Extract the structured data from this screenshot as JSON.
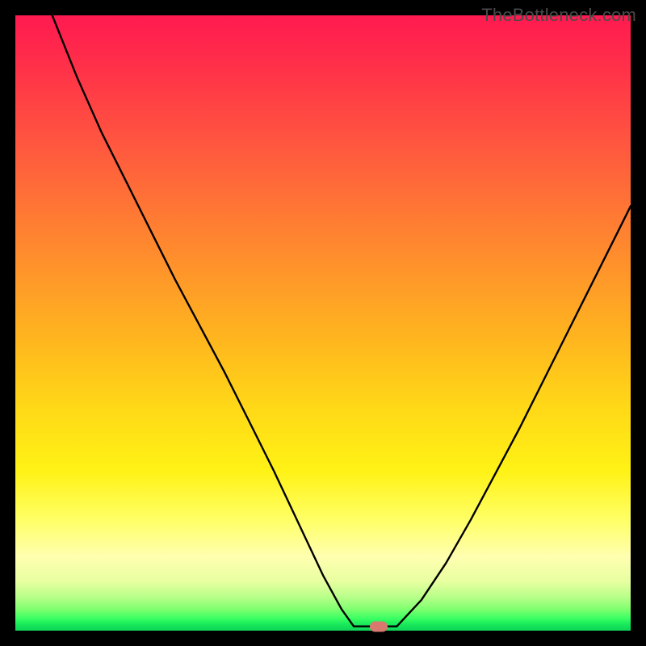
{
  "watermark": "TheBottleneck.com",
  "colors": {
    "frame": "#000000",
    "curve": "#000000",
    "marker": "#d9786f",
    "gradient_top": "#ff1a50",
    "gradient_mid": "#ffd917",
    "gradient_bottom": "#0fd458"
  },
  "chart_data": {
    "type": "line",
    "title": "",
    "xlabel": "",
    "ylabel": "",
    "xlim": [
      0,
      100
    ],
    "ylim": [
      0,
      100
    ],
    "annotations": [
      {
        "type": "marker",
        "x": 59,
        "y": 0.7,
        "fill": "#d9786f"
      }
    ],
    "series": [
      {
        "name": "bottleneck-curve",
        "stroke": "#000000",
        "segments": [
          {
            "x": [
              6,
              10,
              14,
              18,
              22,
              26,
              30,
              34,
              38,
              42,
              46,
              50,
              53,
              55
            ],
            "y": [
              100,
              90,
              81,
              73,
              65,
              57,
              49.5,
              42,
              34,
              26,
              17.5,
              9,
              3.5,
              0.7
            ]
          },
          {
            "x": [
              55,
              62
            ],
            "y": [
              0.7,
              0.7
            ]
          },
          {
            "x": [
              62,
              66,
              70,
              74,
              78,
              82,
              86,
              90,
              94,
              98,
              100
            ],
            "y": [
              0.7,
              5,
              11,
              18,
              25.5,
              33,
              41,
              49,
              57,
              65,
              69
            ]
          }
        ]
      }
    ]
  }
}
